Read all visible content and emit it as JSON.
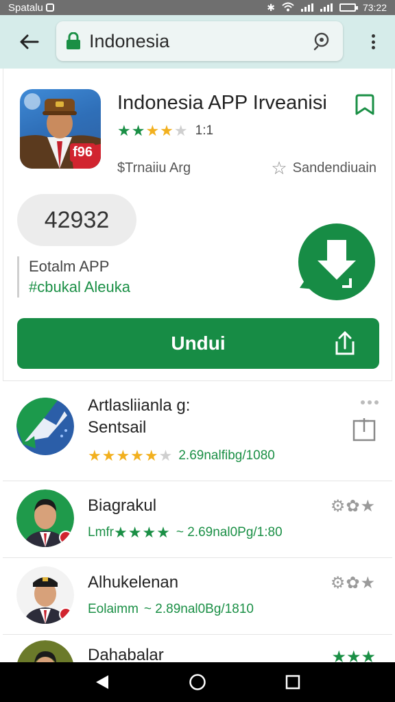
{
  "status_bar": {
    "carrier": "Spatalu",
    "time": "73:22"
  },
  "search": {
    "query": "Indonesia"
  },
  "app": {
    "title": "Indonesia APP Irveanisi",
    "icon_badge": "f96",
    "rating_stars": 4.5,
    "rating_count": "1:1",
    "developer": "$Trnaiiu Arg",
    "similar_label": "Sandendiuain",
    "install_count": "42932",
    "category": "Eotalm APP",
    "category_sub": "#cbukal Aleuka",
    "install_label": "Undui"
  },
  "list": [
    {
      "title_line1": "Artlasliianla g:",
      "title_line2": "Sentsail",
      "stars": 4.5,
      "meta": "2.69nalfibg/1080"
    },
    {
      "title_line1": "Biagrakul",
      "dev": "Lmfr",
      "stars": 4,
      "meta": "~ 2.69nal0Pg/1:80"
    },
    {
      "title_line1": "Alhukelenan",
      "dev": "Eolaimm",
      "meta": "~ 2.89nal0Bg/1810"
    },
    {
      "title_line1": "Dahabalar"
    }
  ],
  "colors": {
    "accent_green": "#178c45",
    "topbar_bg": "#d6ecea",
    "star_yellow": "#f2b01e"
  }
}
